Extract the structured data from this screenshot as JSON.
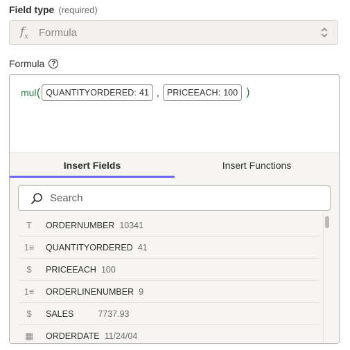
{
  "field_type": {
    "label": "Field type",
    "hint": "(required)",
    "value": "Formula",
    "icon": "fx-icon"
  },
  "formula": {
    "label": "Formula",
    "help_glyph": "?",
    "function_name": "mul",
    "open_paren": "(",
    "close_paren": ")",
    "separator": ",",
    "args": [
      {
        "key": "QUANTITYORDERED:",
        "value": "41"
      },
      {
        "key": "PRICEEACH:",
        "value": "100"
      }
    ]
  },
  "tabs": [
    {
      "label": "Insert Fields",
      "active": true
    },
    {
      "label": "Insert Functions",
      "active": false
    }
  ],
  "search": {
    "placeholder": "Search"
  },
  "fields": [
    {
      "icon": "text-icon",
      "glyph": "T",
      "name": "ORDERNUMBER",
      "value": "10341"
    },
    {
      "icon": "number-icon",
      "glyph": "1≡",
      "name": "QUANTITYORDERED",
      "value": "41"
    },
    {
      "icon": "dollar-icon",
      "glyph": "$",
      "name": "PRICEEACH",
      "value": "100"
    },
    {
      "icon": "number-icon",
      "glyph": "1≡",
      "name": "ORDERLINENUMBER",
      "value": "9"
    },
    {
      "icon": "dollar-icon",
      "glyph": "$",
      "name": "SALES",
      "value": "7737.93"
    },
    {
      "icon": "calendar-icon",
      "glyph": "▦",
      "name": "ORDERDATE",
      "value": "11/24/04"
    }
  ],
  "colors": {
    "accent": "#6c68f0",
    "function": "#2f7a47"
  }
}
